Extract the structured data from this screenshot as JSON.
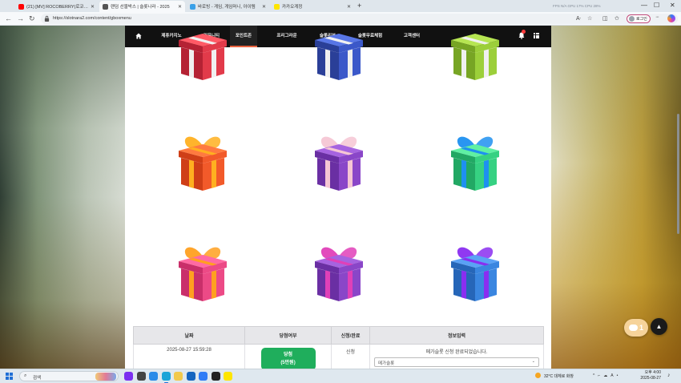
{
  "browser": {
    "tabs": [
      {
        "title": "(21) [MV] ROCOBERRY(로코베리)",
        "favicon_color": "#ff0000"
      },
      {
        "title": "랜덤 선물박스 | 슬롯나라 - 2025",
        "favicon_color": "#555555",
        "active": true
      },
      {
        "title": "바로빙 - 게임, 게임머니, 아이템",
        "favicon_color": "#3aa0e8"
      },
      {
        "title": "카카오계정",
        "favicon_color": "#fee500"
      }
    ],
    "new_tab": "+",
    "window_controls": [
      "—",
      "☐",
      "✕"
    ],
    "system_monitor": "FPS N/A   GPU 17%   CPU 28%",
    "url": "https://slotnara2.com/content/gboxmenu",
    "read_aloud": "Aᐧ",
    "login_label": "로그인"
  },
  "site": {
    "nav": [
      "제휴카지노",
      "커뮤니티",
      "포인트존",
      "프리그라운",
      "슬롯리뷰",
      "슬롯무료체험",
      "고객센터"
    ],
    "active_nav": 2,
    "gifts": [
      {
        "box": "#e23a4a",
        "dark": "#b52234",
        "lid": "#ff5a66",
        "ribbon": "#f0f0f0"
      },
      {
        "box": "#3b58c9",
        "dark": "#2a3f98",
        "lid": "#5876e6",
        "ribbon": "#f0f0f0"
      },
      {
        "box": "#9ccf3a",
        "dark": "#77a524",
        "lid": "#b6e552",
        "ribbon": "#f0f0f0"
      },
      {
        "box": "#f25a2a",
        "dark": "#cf3f17",
        "lid": "#ff7a40",
        "ribbon": "#ffb020"
      },
      {
        "box": "#8a46c8",
        "dark": "#6a2fa3",
        "lid": "#a663e0",
        "ribbon": "#f6c6d4"
      },
      {
        "box": "#36d182",
        "dark": "#22a864",
        "lid": "#5ff0a3",
        "ribbon": "#1e90f0"
      },
      {
        "box": "#ec4a86",
        "dark": "#c92f6a",
        "lid": "#ff6aa3",
        "ribbon": "#ffa020"
      },
      {
        "box": "#8a46c8",
        "dark": "#6a2fa3",
        "lid": "#a663e0",
        "ribbon": "#e040b8"
      },
      {
        "box": "#3a86e0",
        "dark": "#2666b8",
        "lid": "#5aa2f5",
        "ribbon": "#8a2ef0"
      }
    ],
    "table": {
      "headers": [
        "날짜",
        "당첨여부",
        "신청/완료",
        "정보입력"
      ],
      "row": {
        "date": "2025-08-27 15:59:28",
        "win_label": "당첨",
        "win_detail": "(5만원)",
        "status": "신청",
        "message": "메가슬롯 신청 완료되었습니다.",
        "select_value": "메가슬롯"
      }
    },
    "chat_count": "1"
  },
  "taskbar": {
    "search_placeholder": "검색",
    "apps": [
      "#7b2ff0",
      "#444444",
      "#2a8be8",
      "#1aa4d8",
      "#f2c94c",
      "#1565c0",
      "#2f7cf6",
      "#222222",
      "#fee500"
    ],
    "active_app": 3,
    "weather": "32°C  대체로 화창",
    "tray": [
      "^",
      "⌐",
      "☁",
      "A",
      "•"
    ],
    "time": "오후 4:00",
    "date": "2025-08-27"
  }
}
